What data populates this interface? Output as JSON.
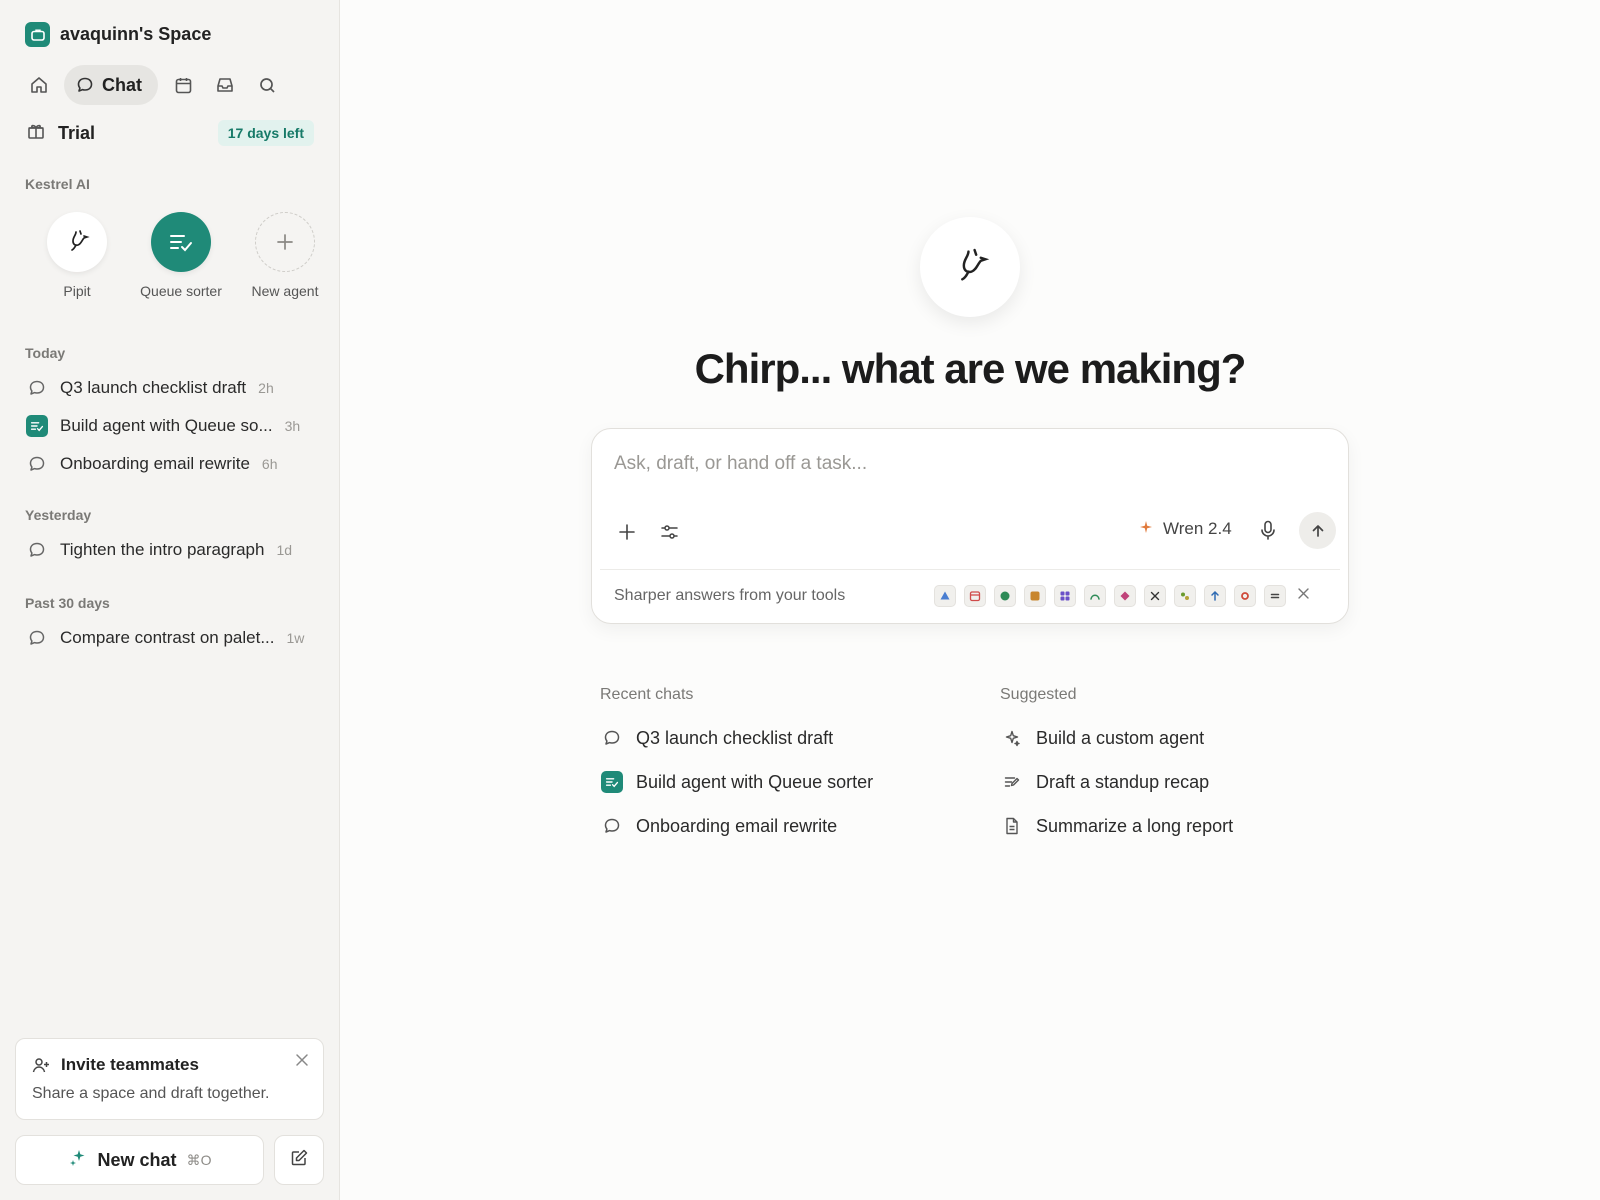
{
  "space": {
    "name": "avaquinn's Space"
  },
  "nav": {
    "chat_label": "Chat"
  },
  "trial": {
    "label": "Trial",
    "badge": "17 days left"
  },
  "agents_section": {
    "label": "Kestrel AI",
    "items": [
      {
        "name": "Pipit"
      },
      {
        "name": "Queue sorter"
      },
      {
        "name": "New agent"
      }
    ]
  },
  "history": {
    "today_label": "Today",
    "today": [
      {
        "title": "Q3 launch checklist draft",
        "time": "2h"
      },
      {
        "title": "Build agent with Queue so...",
        "time": "3h"
      },
      {
        "title": "Onboarding email rewrite",
        "time": "6h"
      }
    ],
    "yesterday_label": "Yesterday",
    "yesterday": [
      {
        "title": "Tighten the intro paragraph",
        "time": "1d"
      }
    ],
    "past_label": "Past 30 days",
    "past": [
      {
        "title": "Compare contrast on palet...",
        "time": "1w"
      }
    ]
  },
  "invite": {
    "title": "Invite teammates",
    "description": "Share a space and draft together."
  },
  "new_chat": {
    "label": "New chat",
    "shortcut": "⌘O"
  },
  "main": {
    "headline": "Chirp... what are we making?",
    "composer": {
      "placeholder": "Ask, draft, or hand off a task...",
      "model": "Wren 2.4",
      "tools_text": "Sharper answers from your tools"
    },
    "recent": {
      "title": "Recent chats",
      "items": [
        {
          "label": "Q3 launch checklist draft"
        },
        {
          "label": "Build agent with Queue sorter"
        },
        {
          "label": "Onboarding email rewrite"
        }
      ]
    },
    "suggested": {
      "title": "Suggested",
      "items": [
        {
          "label": "Build a custom agent"
        },
        {
          "label": "Draft a standup recap"
        },
        {
          "label": "Summarize a long report"
        }
      ]
    }
  },
  "colors": {
    "accent": "#1f8a78",
    "badge_bg": "#e2f2ee",
    "sidebar_bg": "#f5f4f2"
  }
}
